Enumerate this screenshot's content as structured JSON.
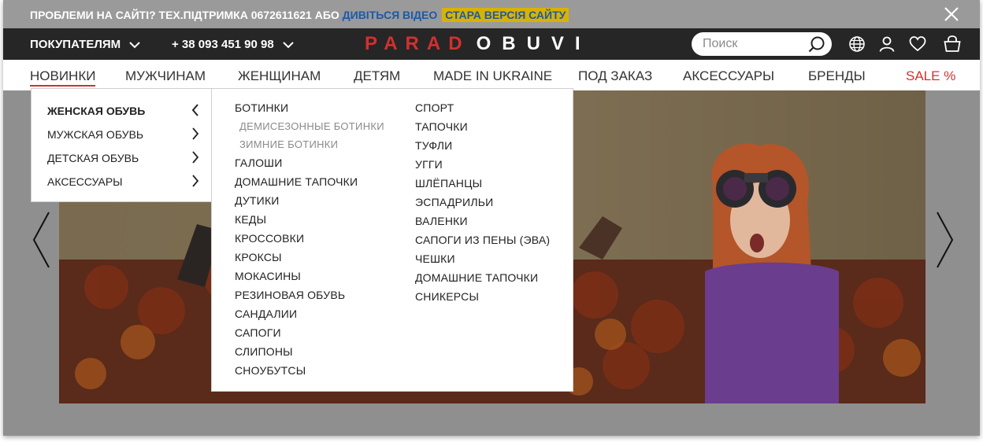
{
  "topbar": {
    "message": "ПРОБЛЕМИ НА САЙТІ? ТЕХ.ПІДТРИМКА 0672611621 АБО ",
    "video_link": "ДИВІТЬСЯ ВІДЕО",
    "old_site": "СТАРА ВЕРСІЯ САЙТУ",
    "close_icon": "close-icon"
  },
  "header": {
    "buyers": "ПОКУПАТЕЛЯМ",
    "phone": "+ 38 093 451 90 98",
    "logo_part1": "PARAD",
    "logo_part2": "OBUVI",
    "search_placeholder": "Поиск",
    "icons": [
      "globe-icon",
      "user-icon",
      "heart-icon",
      "basket-icon"
    ]
  },
  "nav": {
    "items": [
      "НОВИНКИ",
      "МУЖЧИНАМ",
      "ЖЕНЩИНАМ",
      "ДЕТЯМ",
      "MADE IN UKRAINE",
      "ПОД ЗАКАЗ",
      "АКСЕССУАРЫ",
      "БРЕНДЫ",
      "SALE %"
    ],
    "active": "НОВИНКИ"
  },
  "categories": [
    "ЖЕНСКАЯ ОБУВЬ",
    "МУЖСКАЯ ОБУВЬ",
    "ДЕТСКАЯ ОБУВЬ",
    "АКСЕССУАРЫ"
  ],
  "submenu": {
    "col1": [
      "БОТИНКИ",
      "ДЕМИСЕЗОННЫЕ БОТИНКИ",
      "ЗИМНИЕ БОТИНКИ",
      "ГАЛОШИ",
      "ДОМАШНИЕ ТАПОЧКИ",
      "ДУТИКИ",
      "КЕДЫ",
      "КРОССОВКИ",
      "КРОКСЫ",
      "МОКАСИНЫ",
      "РЕЗИНОВАЯ ОБУВЬ",
      "САНДАЛИИ",
      "САПОГИ",
      "СЛИПОНЫ",
      "СНОУБУТСЫ"
    ],
    "col2": [
      "СПОРТ",
      "ТАПОЧКИ",
      "ТУФЛИ",
      "УГГИ",
      "ШЛЁПАНЦЫ",
      "ЭСПАДРИЛЬИ",
      "ВАЛЕНКИ",
      "САПОГИ ИЗ ПЕНЫ (ЭВА)",
      "ЧЕШКИ",
      "ДОМАШНИЕ ТАПОЧКИ",
      "СНИКЕРСЫ"
    ]
  },
  "colors": {
    "accent_red": "#d0312f",
    "header_bg": "#262626",
    "link_blue": "#1c5aa6",
    "old_site_bg": "#d9b200"
  }
}
